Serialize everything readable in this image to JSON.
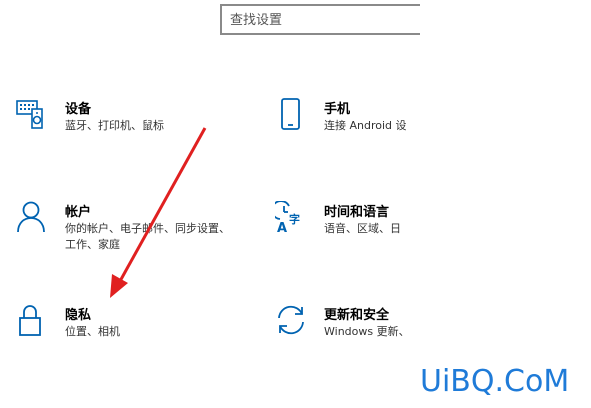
{
  "search": {
    "placeholder": "查找设置"
  },
  "tiles": [
    {
      "title": "设备",
      "desc": "蓝牙、打印机、鼠标",
      "icon": "keyboard-speaker-icon"
    },
    {
      "title": "手机",
      "desc": "连接 Android 设",
      "icon": "phone-icon"
    },
    {
      "title": "帐户",
      "desc": "你的帐户、电子邮件、同步设置、工作、家庭",
      "icon": "person-icon"
    },
    {
      "title": "时间和语言",
      "desc": "语音、区域、日",
      "icon": "time-language-icon"
    },
    {
      "title": "隐私",
      "desc": "位置、相机",
      "icon": "lock-icon"
    },
    {
      "title": "更新和安全",
      "desc": "Windows 更新、",
      "icon": "sync-icon"
    }
  ],
  "watermark": {
    "text": "UiBQ.CoM"
  },
  "colors": {
    "accent": "#0063b1",
    "annotation_arrow": "#e02020",
    "watermark": "#1f7bd8"
  }
}
